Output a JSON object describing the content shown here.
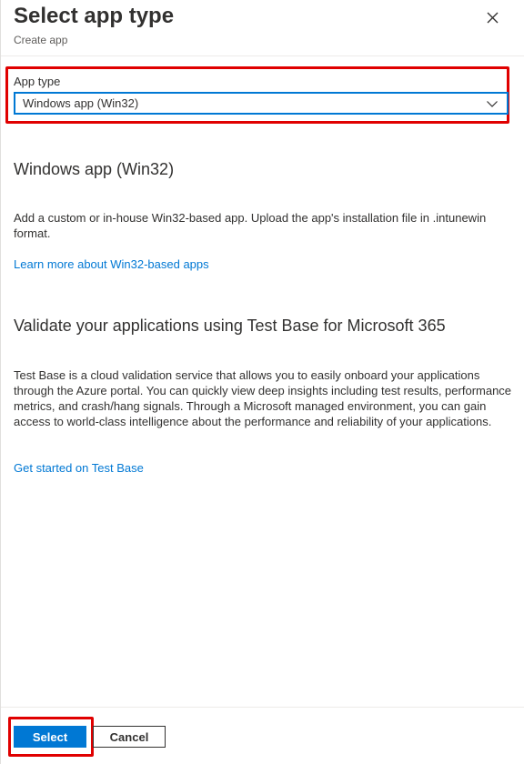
{
  "header": {
    "title": "Select app type",
    "subtitle": "Create app",
    "close_icon": "close-icon"
  },
  "app_type": {
    "label": "App type",
    "selected": "Windows app (Win32)",
    "chevron_icon": "chevron-down-icon"
  },
  "win32_section": {
    "heading": "Windows app (Win32)",
    "description": "Add a custom or in-house Win32-based app. Upload the app's installation file in .intunewin format.",
    "link": "Learn more about Win32-based apps"
  },
  "testbase_section": {
    "heading": "Validate your applications using Test Base for Microsoft 365",
    "description": "Test Base is a cloud validation service that allows you to easily onboard your applications through the Azure portal. You can quickly view deep insights including test results, performance metrics, and crash/hang signals. Through a Microsoft managed environment, you can gain access to world-class intelligence about the performance and reliability of your applications.",
    "link": "Get started on Test Base"
  },
  "footer": {
    "select_label": "Select",
    "cancel_label": "Cancel"
  },
  "colors": {
    "accent": "#0078d4",
    "highlight": "#e00000",
    "text": "#323130"
  }
}
